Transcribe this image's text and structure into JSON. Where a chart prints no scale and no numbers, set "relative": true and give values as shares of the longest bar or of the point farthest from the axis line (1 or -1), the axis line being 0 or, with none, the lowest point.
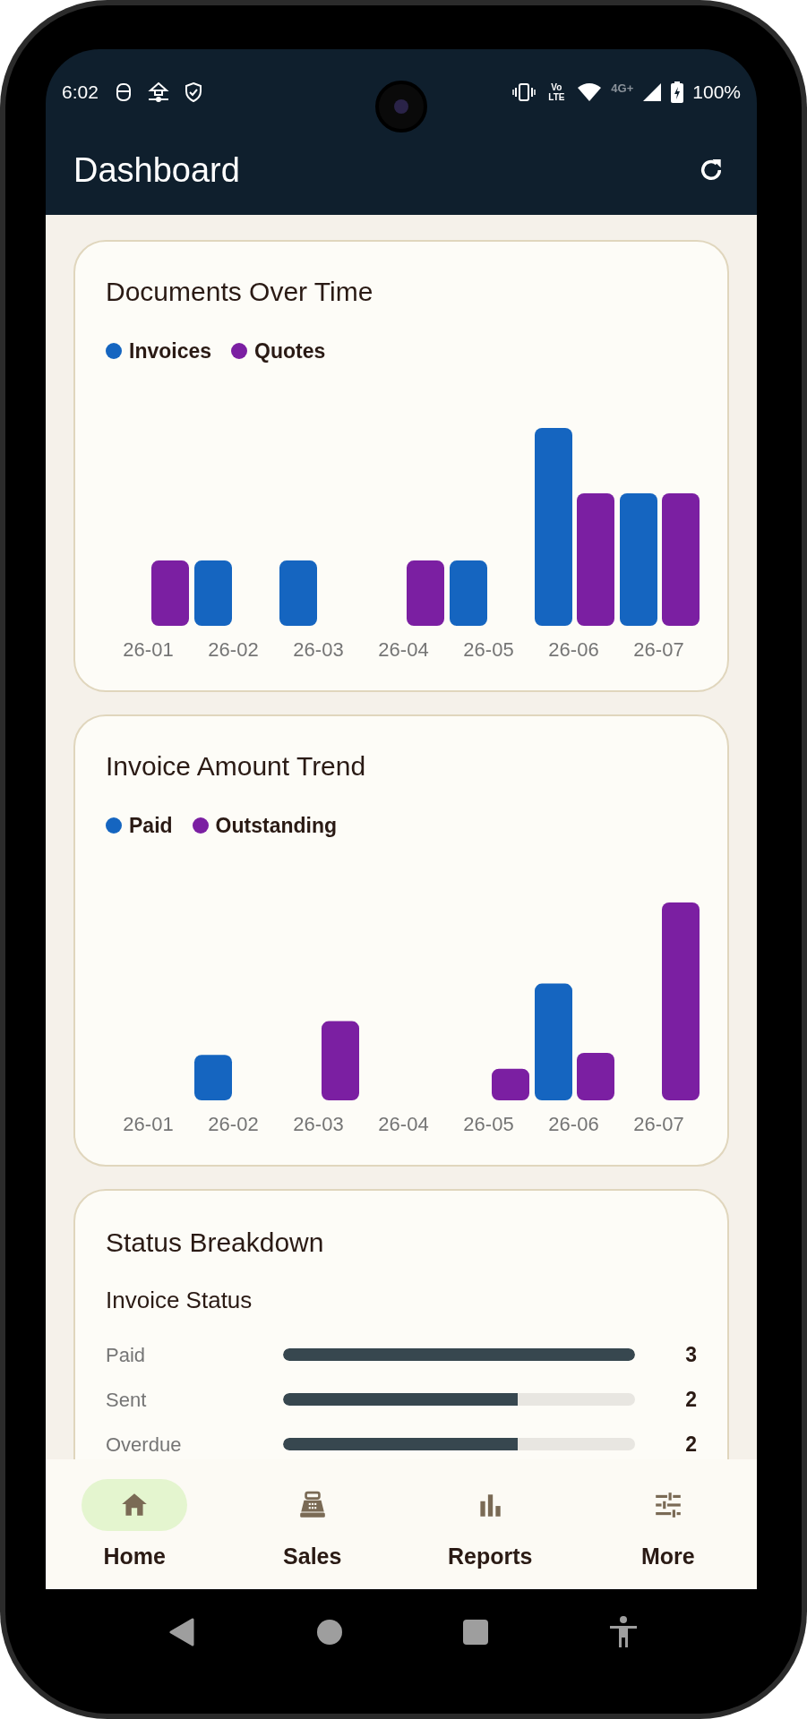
{
  "status_bar": {
    "time": "6:02",
    "volte": "Vo LTE",
    "network_type": "4G+",
    "battery": "100%"
  },
  "app_bar": {
    "title": "Dashboard"
  },
  "cards": [
    {
      "title": "Documents Over Time",
      "chart_data": {
        "type": "bar",
        "categories": [
          "26-01",
          "26-02",
          "26-03",
          "26-04",
          "26-05",
          "26-06",
          "26-07"
        ],
        "relative": true,
        "series": [
          {
            "name": "Invoices",
            "color": "#1565c0",
            "values": [
              0,
              0.33,
              0.33,
              0,
              0.33,
              1,
              0.67
            ]
          },
          {
            "name": "Quotes",
            "color": "#7b1fa2",
            "values": [
              0.33,
              0,
              0,
              0.33,
              0,
              0.67,
              0.67
            ]
          }
        ]
      }
    },
    {
      "title": "Invoice Amount Trend",
      "chart_data": {
        "type": "bar",
        "categories": [
          "26-01",
          "26-02",
          "26-03",
          "26-04",
          "26-05",
          "26-06",
          "26-07"
        ],
        "relative": true,
        "series": [
          {
            "name": "Paid",
            "color": "#1565c0",
            "values": [
              0,
              0.23,
              0,
              0,
              0,
              0.59,
              0
            ]
          },
          {
            "name": "Outstanding",
            "color": "#7b1fa2",
            "values": [
              0,
              0,
              0.4,
              0,
              0.16,
              0.24,
              1
            ]
          }
        ]
      }
    }
  ],
  "status_breakdown": {
    "title": "Status Breakdown",
    "subtitle": "Invoice Status",
    "rows": [
      {
        "label": "Paid",
        "level": 1,
        "count": "3"
      },
      {
        "label": "Sent",
        "level": 0.667,
        "count": "2"
      },
      {
        "label": "Overdue",
        "level": 0.667,
        "count": "2"
      }
    ]
  },
  "bottom_nav": [
    {
      "label": "Home",
      "kind": "home",
      "selected": true
    },
    {
      "label": "Sales",
      "kind": "register",
      "selected": false
    },
    {
      "label": "Reports",
      "kind": "chart",
      "selected": false
    },
    {
      "label": "More",
      "kind": "sliders",
      "selected": false
    }
  ]
}
